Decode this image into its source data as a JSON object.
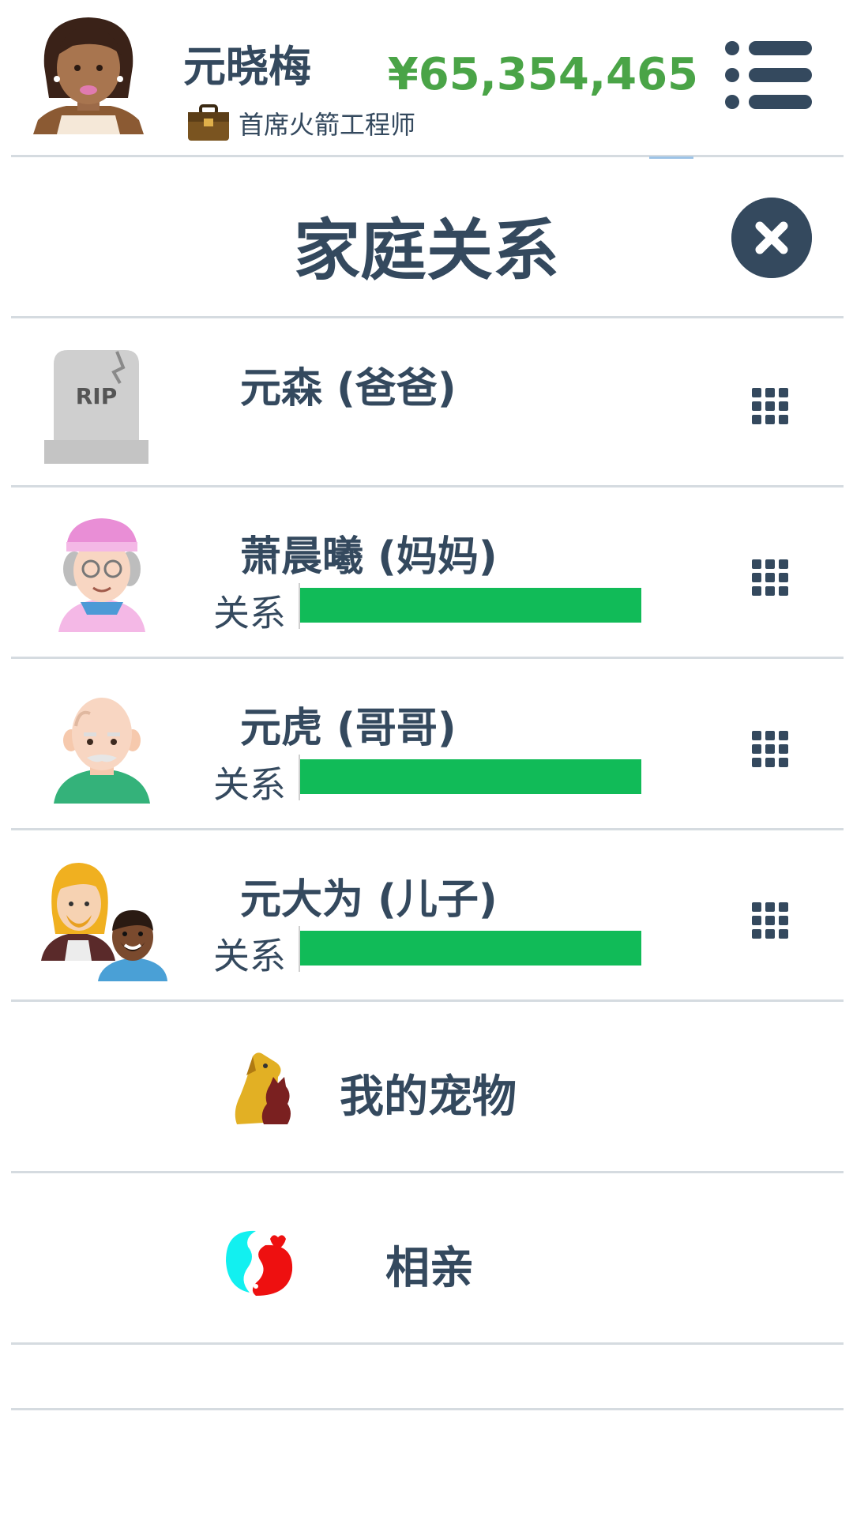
{
  "header": {
    "player_name": "元晓梅",
    "job_title": "首席火箭工程师",
    "money": "¥65,354,465"
  },
  "page": {
    "title": "家庭关系"
  },
  "family": [
    {
      "name": "元森 (爸爸)",
      "deceased": true,
      "tombstone_text": "RIP"
    },
    {
      "name": "萧晨曦 (妈妈)",
      "relationship_label": "关系",
      "relationship_level": 1.0
    },
    {
      "name": "元虎 (哥哥)",
      "relationship_label": "关系",
      "relationship_level": 1.0
    },
    {
      "name": "元大为 (儿子)",
      "relationship_label": "关系",
      "relationship_level": 1.0
    }
  ],
  "menu": {
    "pets_label": "我的宠物",
    "dating_label": "相亲"
  },
  "colors": {
    "text": "#34495e",
    "money": "#4aa447",
    "relationship_bar": "#11bb58",
    "divider": "#d5dbe0"
  },
  "icons": {
    "menu": "list-menu-icon",
    "close": "close-icon",
    "row_options": "grid-dots-icon",
    "job": "briefcase-icon",
    "pets": "dog-cat-icon",
    "dating": "heart-split-icon"
  }
}
